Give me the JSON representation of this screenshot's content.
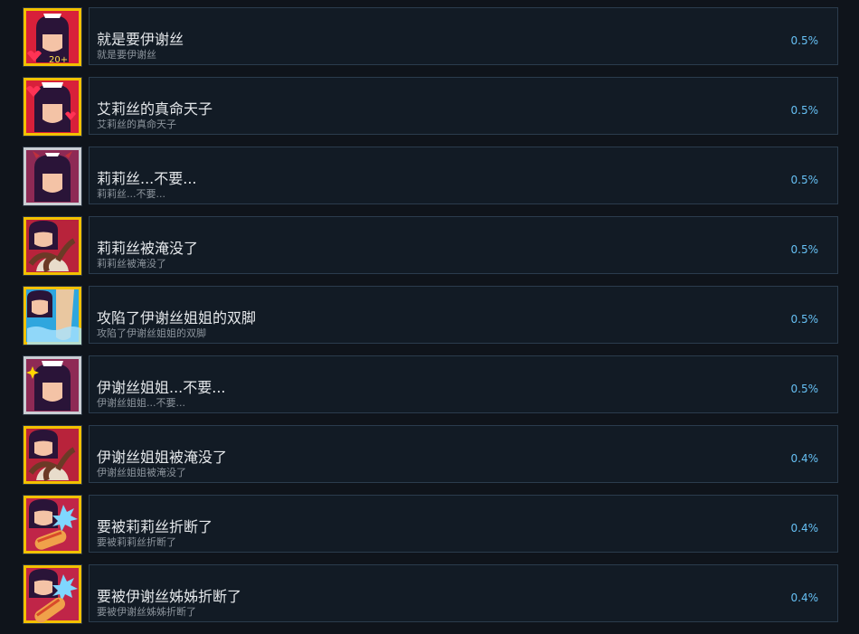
{
  "achievements": [
    {
      "title": "就是要伊谢丝",
      "description": "就是要伊谢丝",
      "percent": "0.5%",
      "icon": "girl-heart-badge-icon",
      "frame": "#f2c100",
      "bg": "#d8203a",
      "badge": "20+"
    },
    {
      "title": "艾莉丝的真命天子",
      "description": "艾莉丝的真命天子",
      "percent": "0.5%",
      "icon": "maid-girl-hearts-icon",
      "frame": "#f2c100",
      "bg": "#d8203a",
      "badge": ""
    },
    {
      "title": "莉莉丝...不要...",
      "description": "莉莉丝...不要...",
      "percent": "0.5%",
      "icon": "demon-girl-icon",
      "frame": "#c9ced3",
      "bg": "#8e2a55",
      "badge": ""
    },
    {
      "title": "莉莉丝被淹没了",
      "description": "莉莉丝被淹没了",
      "percent": "0.5%",
      "icon": "girl-tentacle-icon",
      "frame": "#f2c100",
      "bg": "#b8233b",
      "badge": ""
    },
    {
      "title": "攻陷了伊谢丝姐姐的双脚",
      "description": "攻陷了伊谢丝姐姐的双脚",
      "percent": "0.5%",
      "icon": "girl-feet-icon",
      "frame": "#f2c100",
      "bg": "#2fa6de",
      "badge": ""
    },
    {
      "title": "伊谢丝姐姐...不要...",
      "description": "伊谢丝姐姐...不要...",
      "percent": "0.5%",
      "icon": "maid-girl-icon",
      "frame": "#c9ced3",
      "bg": "#8e2a55",
      "badge": ""
    },
    {
      "title": "伊谢丝姐姐被淹没了",
      "description": "伊谢丝姐姐被淹没了",
      "percent": "0.4%",
      "icon": "girl-tentacle-icon",
      "frame": "#f2c100",
      "bg": "#b8233b",
      "badge": ""
    },
    {
      "title": "要被莉莉丝折断了",
      "description": "要被莉莉丝折断了",
      "percent": "0.4%",
      "icon": "girl-splash-icon",
      "frame": "#f2c100",
      "bg": "#c02548",
      "badge": ""
    },
    {
      "title": "要被伊谢丝姊姊折断了",
      "description": "要被伊谢丝姊姊折断了",
      "percent": "0.4%",
      "icon": "girl-splash-icon",
      "frame": "#f2c100",
      "bg": "#c02548",
      "badge": ""
    }
  ]
}
